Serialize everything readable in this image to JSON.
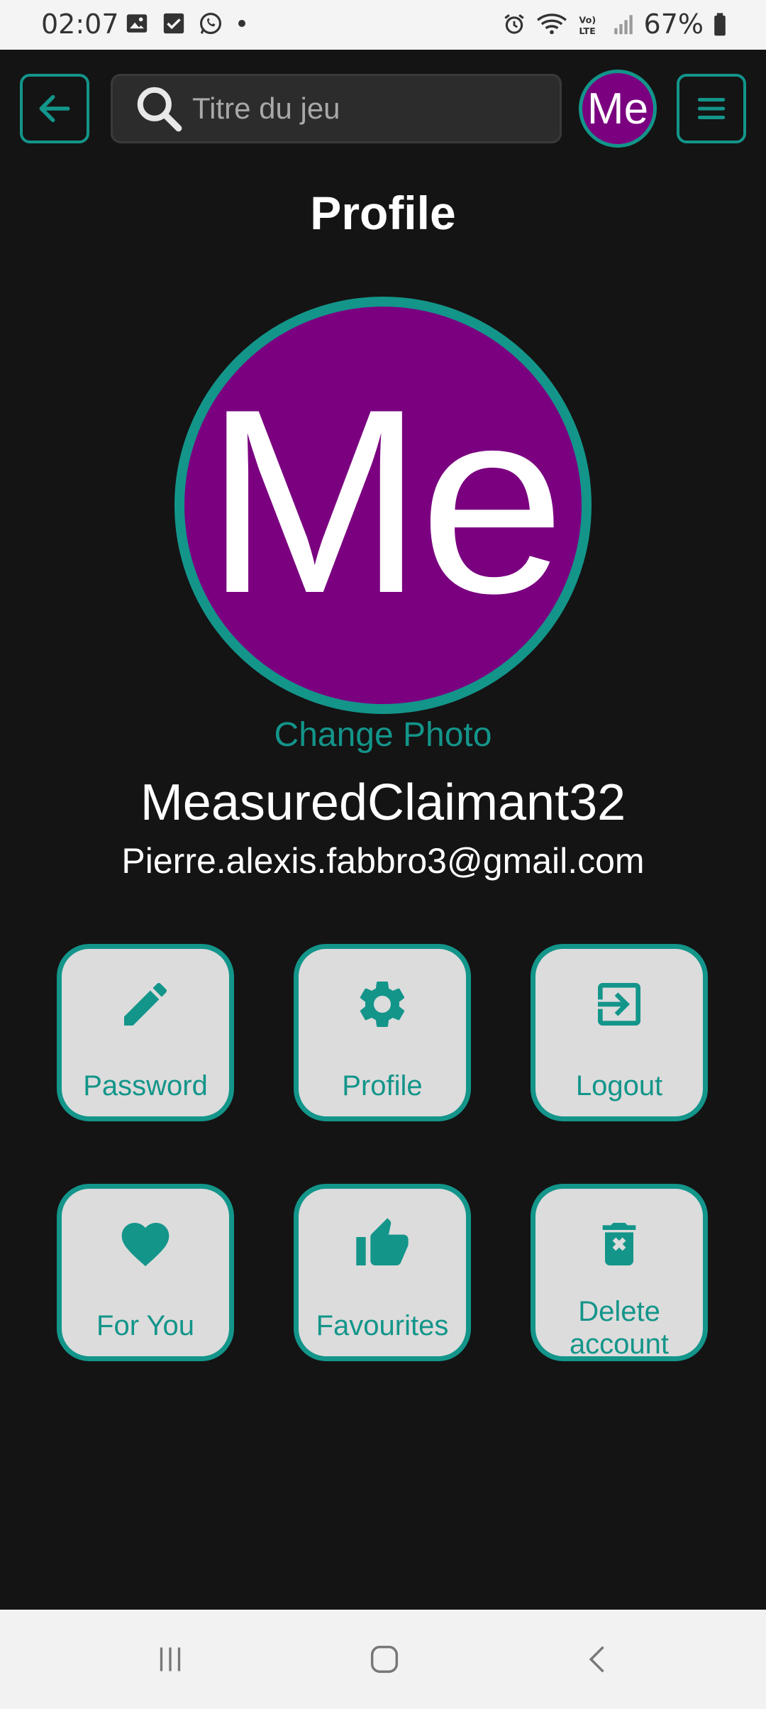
{
  "status_bar": {
    "time": "02:07",
    "battery": "67%"
  },
  "search": {
    "placeholder": "Titre du jeu"
  },
  "avatar": {
    "initials": "Me",
    "color": "#7a0080"
  },
  "accent_color": "#13958a",
  "page": {
    "title": "Profile",
    "change_photo": "Change Photo",
    "username": "MeasuredClaimant32",
    "email": "Pierre.alexis.fabbro3@gmail.com"
  },
  "tiles": [
    {
      "label": "Password",
      "icon": "pencil-icon"
    },
    {
      "label": "Profile",
      "icon": "gear-icon"
    },
    {
      "label": "Logout",
      "icon": "logout-icon"
    },
    {
      "label": "For You",
      "icon": "heart-icon"
    },
    {
      "label": "Favourites",
      "icon": "thumbs-up-icon"
    },
    {
      "label": "Delete account",
      "icon": "trash-icon"
    }
  ]
}
